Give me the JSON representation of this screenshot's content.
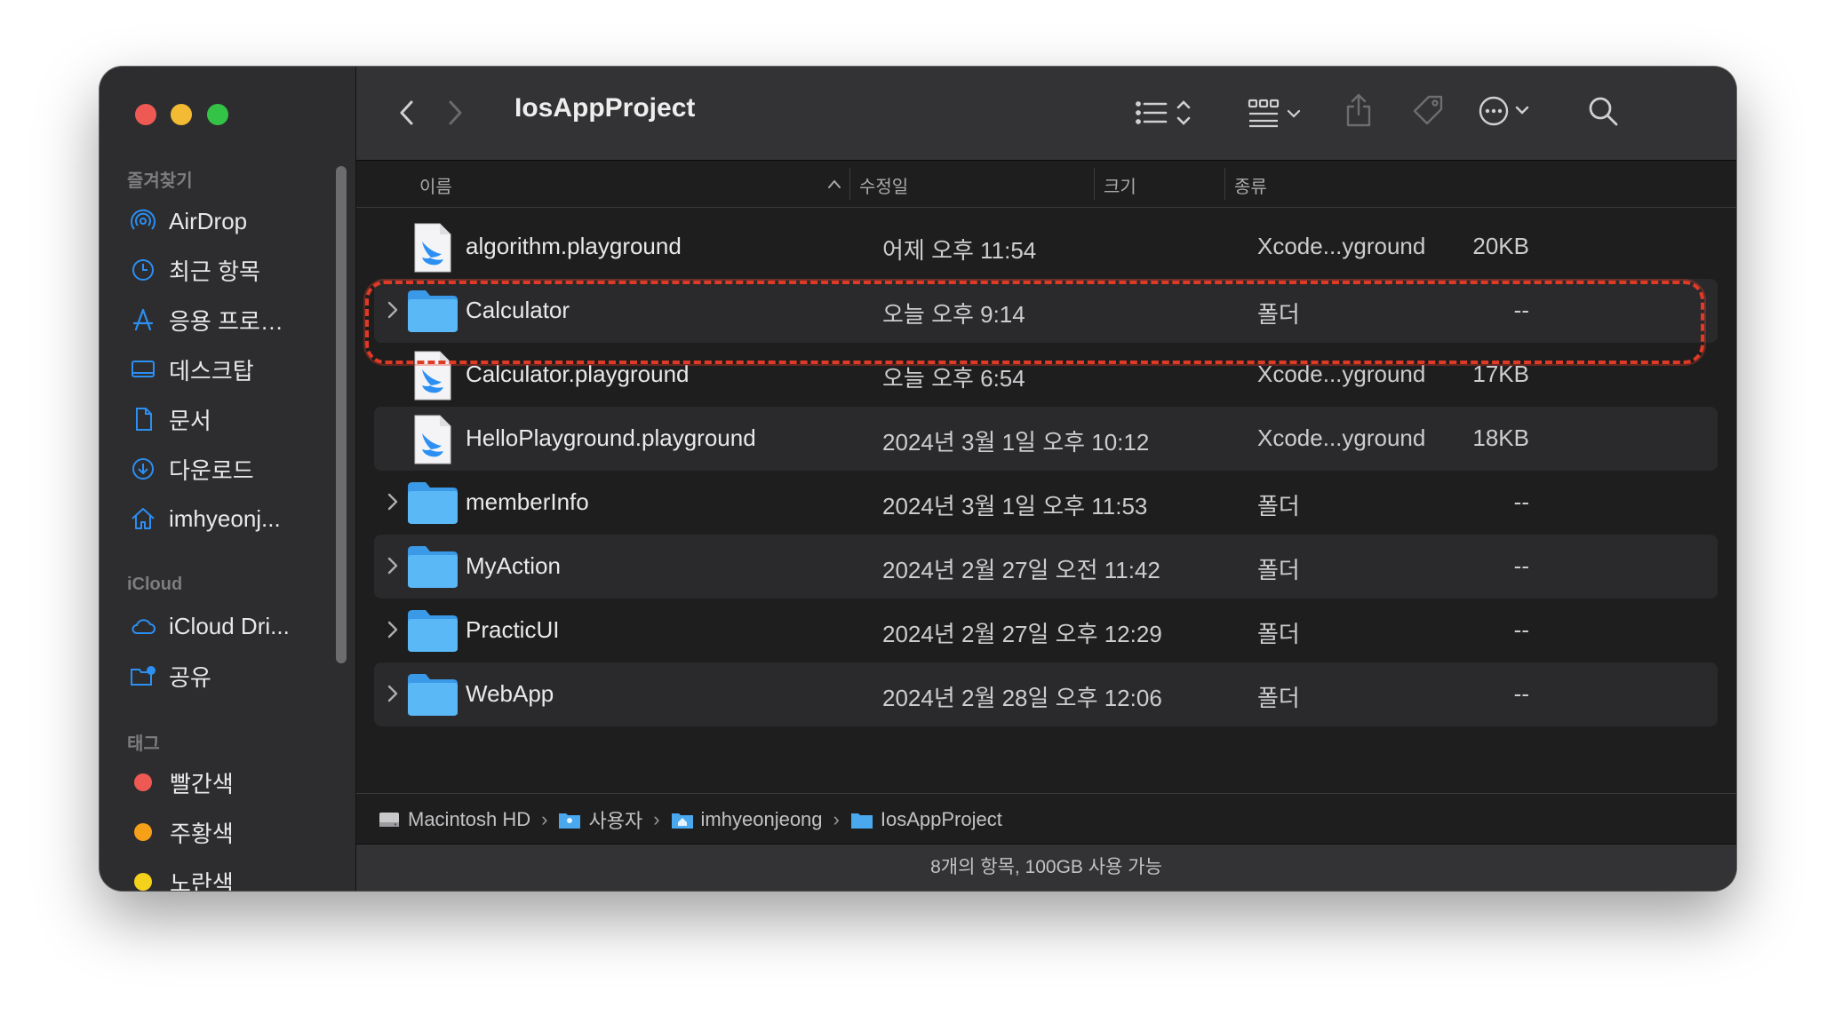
{
  "window": {
    "title": "IosAppProject"
  },
  "sidebar": {
    "favorites_label": "즐겨찾기",
    "favorites": [
      {
        "label": "AirDrop",
        "icon": "airdrop-icon"
      },
      {
        "label": "최근 항목",
        "icon": "clock-icon"
      },
      {
        "label": "응용 프로…",
        "icon": "applications-icon"
      },
      {
        "label": "데스크탑",
        "icon": "desktop-icon"
      },
      {
        "label": "문서",
        "icon": "document-icon"
      },
      {
        "label": "다운로드",
        "icon": "download-icon"
      },
      {
        "label": "imhyeonj...",
        "icon": "home-icon"
      }
    ],
    "icloud_label": "iCloud",
    "icloud": [
      {
        "label": "iCloud Dri...",
        "icon": "cloud-icon"
      },
      {
        "label": "공유",
        "icon": "shared-folder-icon"
      }
    ],
    "tags_label": "태그",
    "tags": [
      {
        "label": "빨간색",
        "color": "#ee5a53"
      },
      {
        "label": "주황색",
        "color": "#f6a01a"
      },
      {
        "label": "노란색",
        "color": "#f4d21c"
      }
    ]
  },
  "columns": {
    "name": "이름",
    "modified": "수정일",
    "size": "크기",
    "kind": "종류"
  },
  "files": [
    {
      "name": "algorithm.playground",
      "modified": "어제 오후 11:54",
      "size": "20KB",
      "kind": "Xcode...yground",
      "type": "playground",
      "expandable": false
    },
    {
      "name": "Calculator",
      "modified": "오늘 오후 9:14",
      "size": "--",
      "kind": "폴더",
      "type": "folder",
      "expandable": true
    },
    {
      "name": "Calculator.playground",
      "modified": "오늘 오후 6:54",
      "size": "17KB",
      "kind": "Xcode...yground",
      "type": "playground",
      "expandable": false
    },
    {
      "name": "HelloPlayground.playground",
      "modified": "2024년 3월 1일 오후 10:12",
      "size": "18KB",
      "kind": "Xcode...yground",
      "type": "playground",
      "expandable": false
    },
    {
      "name": "memberInfo",
      "modified": "2024년 3월 1일 오후 11:53",
      "size": "--",
      "kind": "폴더",
      "type": "folder",
      "expandable": true
    },
    {
      "name": "MyAction",
      "modified": "2024년 2월 27일 오전 11:42",
      "size": "--",
      "kind": "폴더",
      "type": "folder",
      "expandable": true
    },
    {
      "name": "PracticUI",
      "modified": "2024년 2월 27일 오후 12:29",
      "size": "--",
      "kind": "폴더",
      "type": "folder",
      "expandable": true
    },
    {
      "name": "WebApp",
      "modified": "2024년 2월 28일 오후 12:06",
      "size": "--",
      "kind": "폴더",
      "type": "folder",
      "expandable": true
    }
  ],
  "path": [
    {
      "label": "Macintosh HD",
      "icon": "hard-drive-icon"
    },
    {
      "label": "사용자",
      "icon": "users-folder-icon"
    },
    {
      "label": "imhyeonjeong",
      "icon": "home-folder-icon"
    },
    {
      "label": "IosAppProject",
      "icon": "folder-icon"
    }
  ],
  "status": "8개의 항목, 100GB 사용 가능",
  "colors": {
    "accent": "#2b8ff3",
    "highlight_annotation": "#e03a26",
    "folder": "#4fb4f5"
  }
}
